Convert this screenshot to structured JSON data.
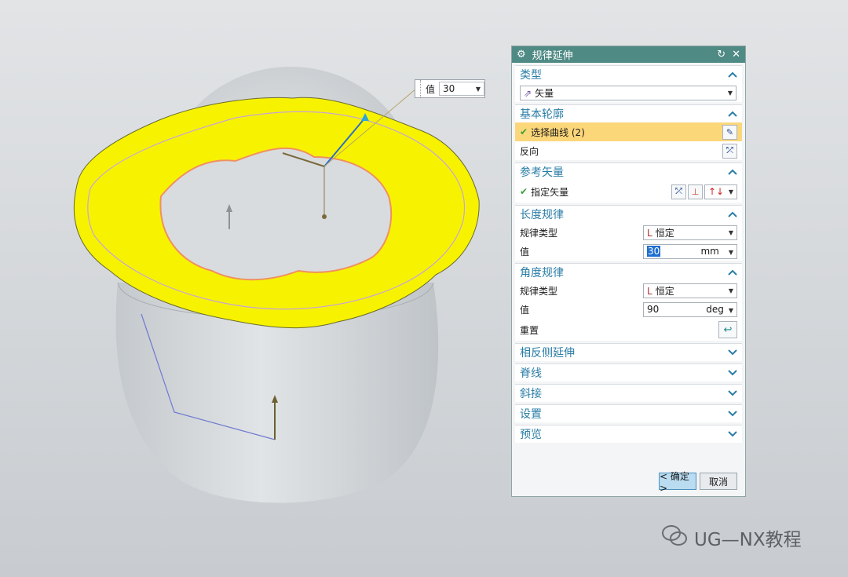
{
  "floating_input": {
    "label": "值",
    "value": "30"
  },
  "dialog": {
    "title": "规律延伸",
    "sections": {
      "type": {
        "header": "类型",
        "selected": "矢量"
      },
      "base_profile": {
        "header": "基本轮廓",
        "select_curve": "选择曲线 (2)",
        "reverse": "反向"
      },
      "ref_vector": {
        "header": "参考矢量",
        "specify_vector": "指定矢量"
      },
      "length_law": {
        "header": "长度规律",
        "law_type_label": "规律类型",
        "law_type_value": "恒定",
        "value_label": "值",
        "value": "30",
        "unit": "mm"
      },
      "angle_law": {
        "header": "角度规律",
        "law_type_label": "规律类型",
        "law_type_value": "恒定",
        "value_label": "值",
        "value": "90",
        "unit": "deg",
        "reset_label": "重置"
      }
    },
    "collapsed_sections": [
      "相反侧延伸",
      "脊线",
      "斜接",
      "设置",
      "预览"
    ],
    "buttons": {
      "ok": "< 确定 >",
      "cancel": "取消"
    }
  },
  "watermark": {
    "text": "UG—NX教程"
  },
  "colors": {
    "titlebar": "#4f8a84",
    "section_header": "#2a7da6",
    "highlight": "#fcd77a",
    "surface_yellow": "#f7f300",
    "body_gray": "#cfd3d6"
  }
}
